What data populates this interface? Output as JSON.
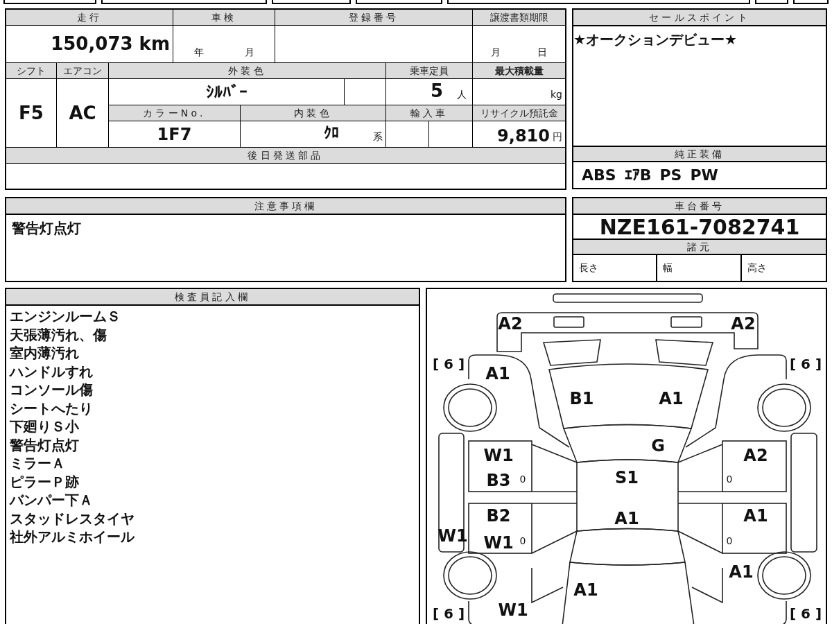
{
  "vehicle_table": {
    "mileage_label": "走行",
    "mileage": "150,073 km",
    "inspection_label": "車検",
    "inspection_year": "年",
    "inspection_month": "月",
    "registration_label": "登録番号",
    "transfer_deadline_label": "譲渡書類期限",
    "transfer_month": "月",
    "transfer_day": "日",
    "shift_label": "シフト",
    "shift": "F5",
    "ac_label": "エアコン",
    "ac": "AC",
    "exterior_color_label": "外装色",
    "exterior_color": "ｼﾙﾊﾞｰ",
    "capacity_label": "乗車定員",
    "capacity": "5",
    "capacity_unit": "人",
    "max_load_label": "最大積載量",
    "max_load_unit": "kg",
    "color_no_label": "カラーNo.",
    "color_no": "1F7",
    "interior_color_label": "内装色",
    "interior_color": "ｸﾛ",
    "interior_color_suffix": "系",
    "import_label": "輸入車",
    "recycle_label": "リサイクル預託金",
    "recycle_fee": "9,810",
    "recycle_unit": "円",
    "later_parts_label": "後日発送部品"
  },
  "sales_point": {
    "label": "セールスポイント",
    "text": "★オークションデビュー★"
  },
  "equipment": {
    "label": "純正装備",
    "items": [
      "ABS",
      "ｴｱB",
      "PS",
      "PW"
    ]
  },
  "notes": {
    "label": "注意事項欄",
    "text": "警告灯点灯"
  },
  "chassis": {
    "label": "車台番号",
    "number": "NZE161-7082741",
    "specs_label": "諸元",
    "specs": [
      "長さ",
      "幅",
      "高さ"
    ]
  },
  "inspector": {
    "label": "検査員記入欄",
    "lines": [
      "エンジンルームＳ",
      "天張薄汚れ、傷",
      "室内薄汚れ",
      "ハンドルすれ",
      "コンソール傷",
      "シートへたり",
      "下廻りＳ小",
      "警告灯点灯",
      "ミラーＡ",
      "ピラーＰ跡",
      "バンパー下Ａ",
      "スタッドレスタイヤ",
      "社外アルミホイール"
    ]
  },
  "diagram": {
    "marks": [
      {
        "kind": "grade",
        "text": "A2"
      },
      {
        "kind": "grade",
        "text": "A2"
      },
      {
        "kind": "tire",
        "text": "[ 6 ]"
      },
      {
        "kind": "grade",
        "text": "A1"
      },
      {
        "kind": "tire",
        "text": "[ 6 ]"
      },
      {
        "kind": "grade",
        "text": "B1"
      },
      {
        "kind": "grade",
        "text": "A1"
      },
      {
        "kind": "grade",
        "text": "G"
      },
      {
        "kind": "grade",
        "text": "W1"
      },
      {
        "kind": "grade",
        "text": "A2"
      },
      {
        "kind": "grade",
        "text": "B3"
      },
      {
        "kind": "small",
        "text": "0"
      },
      {
        "kind": "grade",
        "text": "S1"
      },
      {
        "kind": "small",
        "text": "0"
      },
      {
        "kind": "grade",
        "text": "B2"
      },
      {
        "kind": "grade",
        "text": "A1"
      },
      {
        "kind": "grade",
        "text": "A1"
      },
      {
        "kind": "grade",
        "text": "W1"
      },
      {
        "kind": "grade",
        "text": "W1"
      },
      {
        "kind": "small",
        "text": "0"
      },
      {
        "kind": "small",
        "text": "0"
      },
      {
        "kind": "grade",
        "text": "A1"
      },
      {
        "kind": "grade",
        "text": "A1"
      },
      {
        "kind": "tire",
        "text": "[ 6 ]"
      },
      {
        "kind": "grade",
        "text": "W1"
      },
      {
        "kind": "tire",
        "text": "[ 6 ]"
      }
    ]
  }
}
